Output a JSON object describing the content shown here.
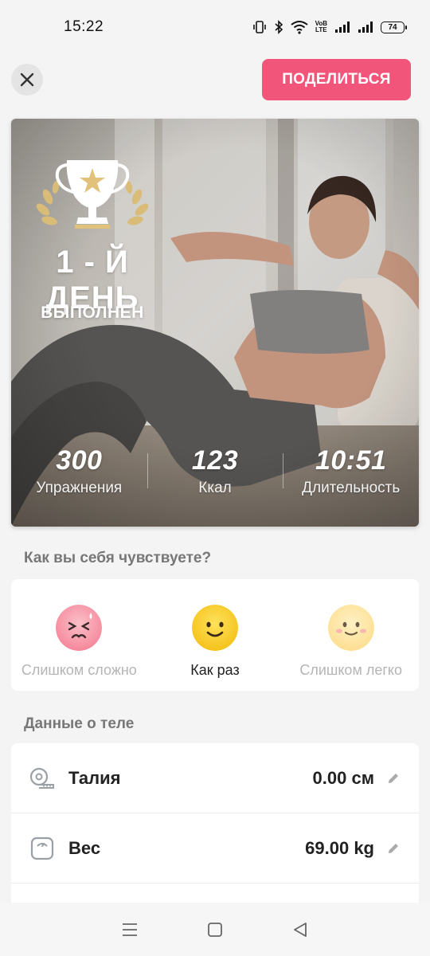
{
  "status_bar": {
    "time": "15:22",
    "volte_top": "VoB",
    "volte_bottom": "LTE",
    "battery": "74"
  },
  "header": {
    "close_icon": "close-icon",
    "share_label": "ПОДЕЛИТЬСЯ"
  },
  "hero": {
    "title": "1 - Й ДЕНЬ",
    "subtitle": "ВЫПОЛНЕН",
    "stats": [
      {
        "value": "300",
        "label": "Упражнения"
      },
      {
        "value": "123",
        "label": "Ккал"
      },
      {
        "value": "10:51",
        "label": "Длительность"
      }
    ]
  },
  "feelings": {
    "title": "Как вы себя чувствуете?",
    "options": [
      {
        "label": "Слишком сложно",
        "icon": "tired-face-icon",
        "selected": false
      },
      {
        "label": "Как раз",
        "icon": "smile-face-icon",
        "selected": true
      },
      {
        "label": "Слишком легко",
        "icon": "happy-face-icon",
        "selected": false
      }
    ]
  },
  "body_data": {
    "title": "Данные о теле",
    "rows": [
      {
        "label": "Талия",
        "value": "0.00 см",
        "icon": "tape-measure-icon"
      },
      {
        "label": "Вес",
        "value": "69.00 kg",
        "icon": "scale-icon"
      }
    ]
  },
  "colors": {
    "accent": "#f2557a",
    "gold": "#e2c27a",
    "face_selected": "#f7c928",
    "face_hard": "#f78a9c",
    "face_easy": "#fde3a0"
  }
}
